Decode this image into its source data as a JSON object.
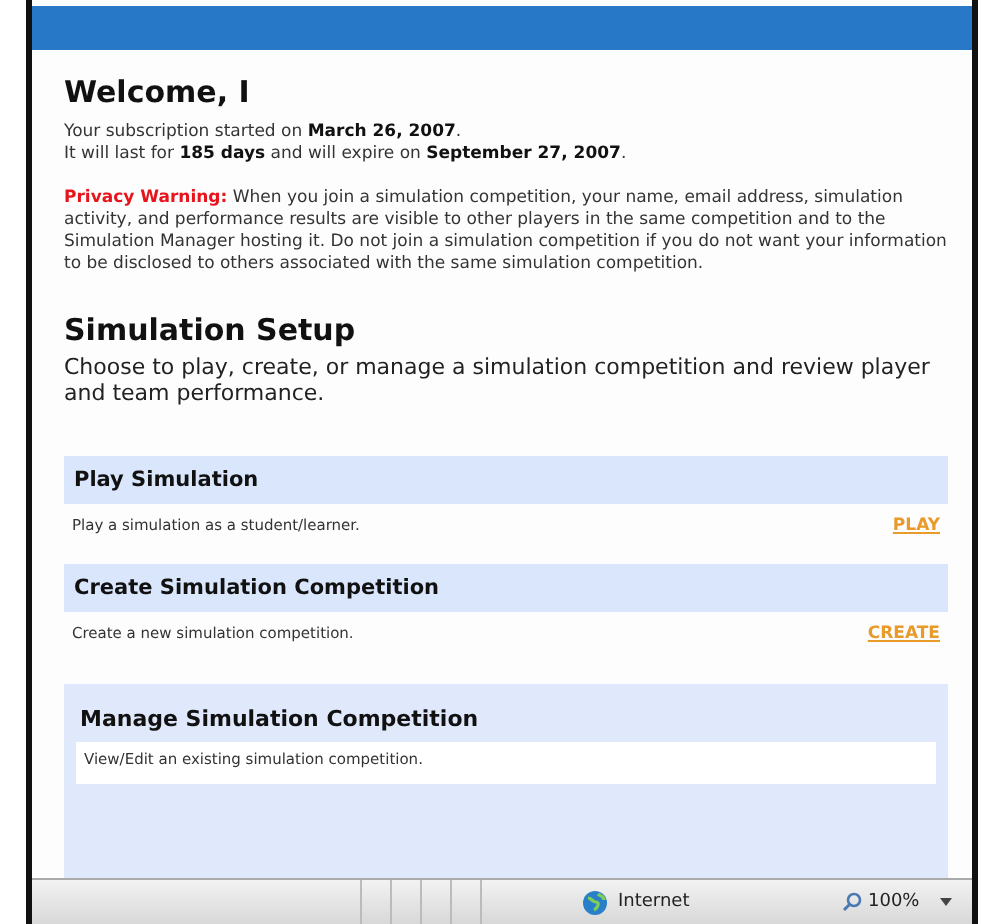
{
  "welcome": "Welcome, I",
  "subscription": [
    "Your subscription started on **March 26, 2007**.",
    "It will last for **185 days** and will expire on **September 27, 2007**."
  ],
  "privacy": {
    "label": "Privacy Warning:",
    "text": "When you join a simulation competition, your name, email address, simulation activity, and performance results are visible to other players in the same competition and to the Simulation Manager hosting it. Do not join a simulation competition if you do not want your information to be disclosed to others associated with the same simulation competition."
  },
  "setup": {
    "title": "Simulation Setup",
    "description": "Choose to play, create, or manage a simulation competition and review player and team performance."
  },
  "sections": [
    {
      "kind": "link",
      "title": "Play Simulation",
      "description": "Play a simulation as a student/learner.",
      "action": "PLAY"
    },
    {
      "kind": "link",
      "title": "Create Simulation Competition",
      "description": "Create a new simulation competition.",
      "action": "CREATE"
    },
    {
      "kind": "panel",
      "title": "Manage Simulation Competition",
      "description": "View/Edit an existing simulation competition."
    }
  ],
  "status_bar": {
    "zone": "Internet",
    "zoom": "100%"
  }
}
